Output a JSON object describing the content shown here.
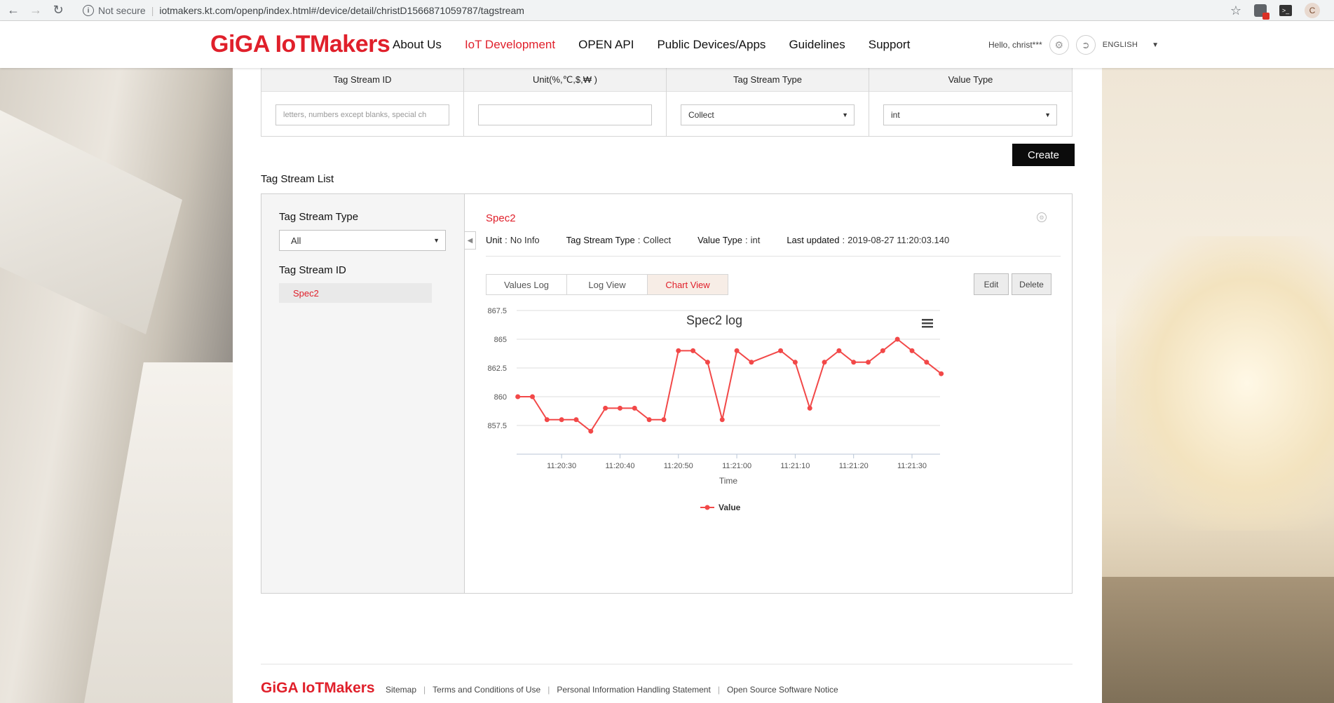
{
  "browser": {
    "security": "Not secure",
    "url": "iotmakers.kt.com/openp/index.html#/device/detail/christD1566871059787/tagstream",
    "profile_initial": "C"
  },
  "header": {
    "logo": "GiGA IoTMakers",
    "nav": [
      "About Us",
      "IoT Development",
      "OPEN API",
      "Public Devices/Apps",
      "Guidelines",
      "Support"
    ],
    "active_nav": "IoT Development",
    "greeting": "Hello, christ***",
    "language": "ENGLISH"
  },
  "create_form": {
    "columns": [
      {
        "header": "Tag Stream ID",
        "placeholder": "letters, numbers except blanks, special ch",
        "value": ""
      },
      {
        "header": "Unit(%,℃,$,₩ )",
        "placeholder": "",
        "value": ""
      },
      {
        "header": "Tag Stream Type",
        "value": "Collect"
      },
      {
        "header": "Value Type",
        "value": "int"
      }
    ],
    "create_label": "Create"
  },
  "list": {
    "title": "Tag Stream List",
    "type_label": "Tag Stream Type",
    "type_value": "All",
    "id_label": "Tag Stream ID",
    "items": [
      "Spec2"
    ]
  },
  "detail": {
    "name": "Spec2",
    "unit_label": "Unit",
    "unit_value": "No Info",
    "type_label": "Tag Stream Type",
    "type_value": "Collect",
    "value_type_label": "Value Type",
    "value_type_value": "int",
    "updated_label": "Last updated",
    "updated_value": "2019-08-27 11:20:03.140",
    "tabs": [
      "Values Log",
      "Log View",
      "Chart View"
    ],
    "active_tab": "Chart View",
    "edit_label": "Edit",
    "delete_label": "Delete"
  },
  "chart_data": {
    "type": "line",
    "title": "Spec2 log",
    "xlabel": "Time",
    "ylabel": "",
    "ylim": [
      855,
      867.5
    ],
    "y_ticks": [
      "857.5",
      "860",
      "862.5",
      "865",
      "867.5"
    ],
    "x_ticks": [
      "11:20:30",
      "11:20:40",
      "11:20:50",
      "11:21:00",
      "11:21:10",
      "11:21:20",
      "11:21:30"
    ],
    "x_tick_seconds": [
      30,
      40,
      50,
      60,
      70,
      80,
      90
    ],
    "x_range_seconds": [
      22.3,
      94.8
    ],
    "series": [
      {
        "name": "Value",
        "color": "#f24848",
        "x_seconds": [
          22.5,
          25,
          27.5,
          30,
          32.5,
          35,
          37.5,
          40,
          42.5,
          45,
          47.5,
          50,
          52.5,
          55,
          57.5,
          60,
          62.5,
          67.5,
          70,
          72.5,
          75,
          77.5,
          80,
          82.5,
          85,
          87.5,
          90,
          92.5,
          95
        ],
        "values": [
          860,
          860,
          858,
          858,
          858,
          857,
          859,
          859,
          859,
          858,
          858,
          864,
          864,
          863,
          858,
          864,
          863,
          864,
          863,
          859,
          863,
          864,
          863,
          863,
          864,
          865,
          864,
          863,
          862
        ]
      }
    ],
    "legend": "bottom-center",
    "grid": true
  },
  "footer": {
    "logo": "GiGA IoTMakers",
    "links": [
      "Sitemap",
      "Terms and Conditions of Use",
      "Personal Information Handling Statement",
      "Open Source Software Notice"
    ]
  }
}
